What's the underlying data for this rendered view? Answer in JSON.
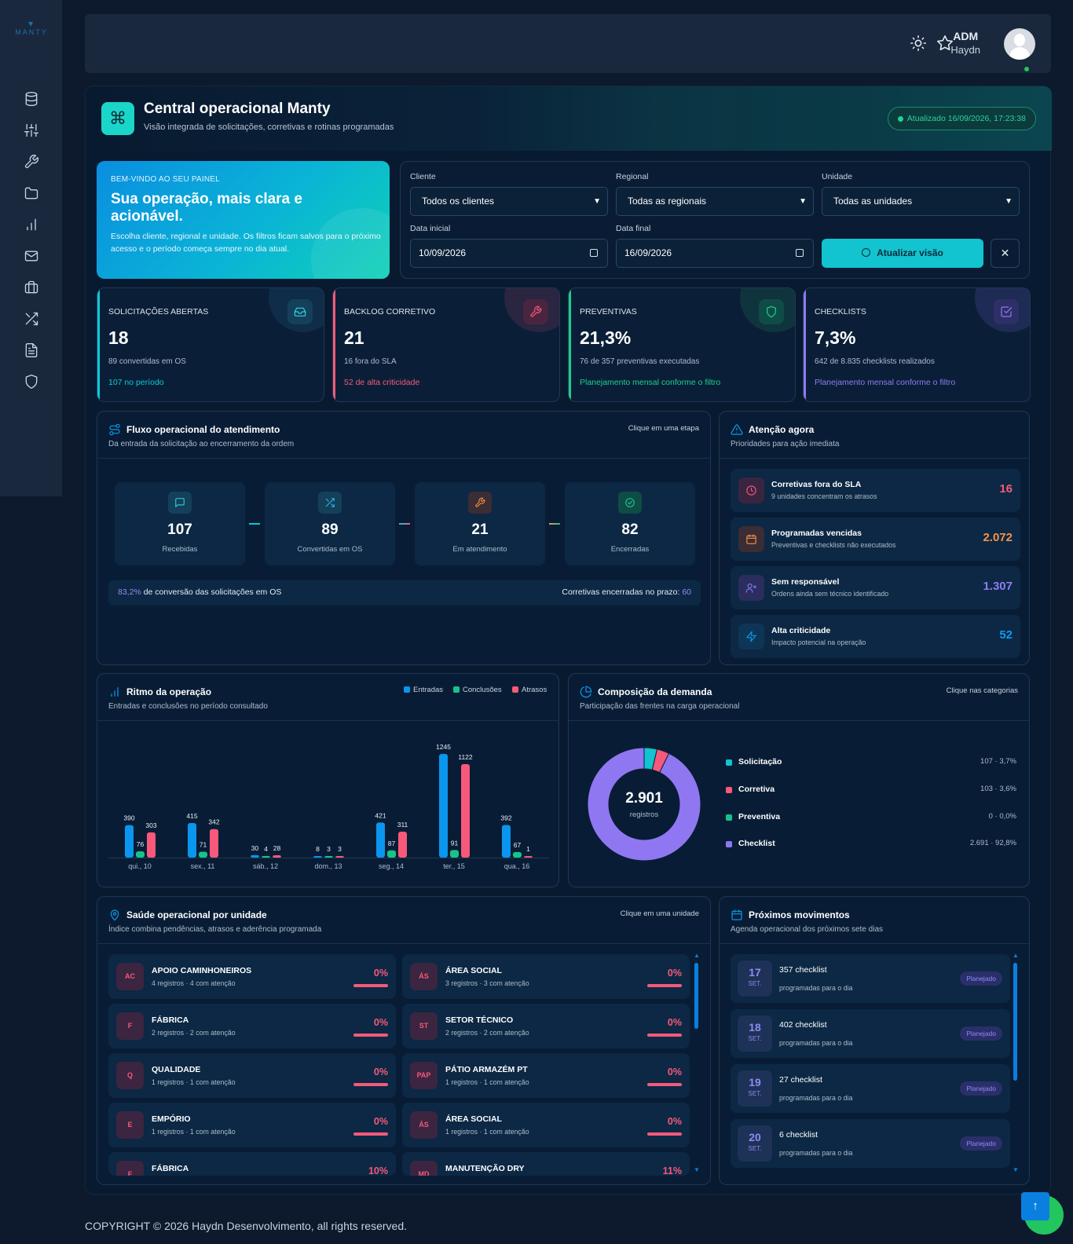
{
  "sidebar": {
    "logo": "MANTY",
    "icons": [
      "database-icon",
      "sliders-icon",
      "wrench-icon",
      "folder-icon",
      "bar-chart-icon",
      "mail-icon",
      "briefcase-icon",
      "shuffle-icon",
      "document-icon",
      "shield-icon"
    ]
  },
  "topbar": {
    "user_role": "ADM",
    "user_name": "Haydn"
  },
  "header": {
    "title": "Central operacional Manty",
    "subtitle": "Visão integrada de solicitações, corretivas e rotinas programadas",
    "updated": "Atualizado 16/09/2026, 17:23:38"
  },
  "welcome": {
    "eyebrow": "BEM-VINDO AO SEU PAINEL",
    "title": "Sua operação, mais clara e acionável.",
    "text": "Escolha cliente, regional e unidade. Os filtros ficam salvos para o próximo acesso e o período começa sempre no dia atual."
  },
  "filters": {
    "client_label": "Cliente",
    "client_value": "Todos os clientes",
    "region_label": "Regional",
    "region_value": "Todas as regionais",
    "unit_label": "Unidade",
    "unit_value": "Todas as unidades",
    "start_label": "Data inicial",
    "start_value": "10/09/2026",
    "end_label": "Data final",
    "end_value": "16/09/2026",
    "update_button": "Atualizar visão",
    "clear_button": "✕"
  },
  "kpis": [
    {
      "label": "SOLICITAÇÕES ABERTAS",
      "value": "18",
      "detail": "89 convertidas em OS",
      "note": "107 no período",
      "color": "#0fc9d6"
    },
    {
      "label": "BACKLOG CORRETIVO",
      "value": "21",
      "detail": "16 fora do SLA",
      "note": "52 de alta criticidade",
      "color": "#f6597a"
    },
    {
      "label": "PREVENTIVAS",
      "value": "21,3%",
      "detail": "76 de 357 preventivas executadas",
      "note": "Planejamento mensal conforme o filtro",
      "color": "#1fcf8e"
    },
    {
      "label": "CHECKLISTS",
      "value": "7,3%",
      "detail": "642 de 8.835 checklists realizados",
      "note": "Planejamento mensal conforme o filtro",
      "color": "#8f7bf2"
    }
  ],
  "flow": {
    "title": "Fluxo operacional do atendimento",
    "subtitle": "Da entrada da solicitação ao encerramento da ordem",
    "hint": "Clique em uma etapa",
    "steps": [
      {
        "value": "107",
        "label": "Recebidas"
      },
      {
        "value": "89",
        "label": "Convertidas em OS"
      },
      {
        "value": "21",
        "label": "Em atendimento"
      },
      {
        "value": "82",
        "label": "Encerradas"
      }
    ],
    "conversion_pct": "83,2%",
    "conversion_text": "de conversão das solicitações em OS",
    "ontime_label": "Corretivas encerradas no prazo:",
    "ontime_value": "60"
  },
  "attention": {
    "title": "Atenção agora",
    "subtitle": "Prioridades para ação imediata",
    "items": [
      {
        "title": "Corretivas fora do SLA",
        "desc": "9 unidades concentram os atrasos",
        "value": "16",
        "color": "#f6597a"
      },
      {
        "title": "Programadas vencidas",
        "desc": "Preventivas e checklists não executados",
        "value": "2.072",
        "color": "#f7924a"
      },
      {
        "title": "Sem responsável",
        "desc": "Ordens ainda sem técnico identificado",
        "value": "1.307",
        "color": "#8f7bf2"
      },
      {
        "title": "Alta criticidade",
        "desc": "Impacto potencial na operação",
        "value": "52",
        "color": "#0a9bf0"
      }
    ]
  },
  "rhythm": {
    "title": "Ritmo da operação",
    "subtitle": "Entradas e conclusões no período consultado",
    "legend": [
      "Entradas",
      "Conclusões",
      "Atrasos"
    ]
  },
  "chart_data": {
    "type": "bar",
    "categories": [
      "qui., 10",
      "sex., 11",
      "sáb., 12",
      "dom., 13",
      "seg., 14",
      "ter., 15",
      "qua., 16"
    ],
    "series": [
      {
        "name": "Entradas",
        "values": [
          390,
          415,
          30,
          8,
          421,
          1245,
          392
        ],
        "color": "#0a95ef"
      },
      {
        "name": "Conclusões",
        "values": [
          76,
          71,
          4,
          3,
          87,
          91,
          67
        ],
        "color": "#16c48a"
      },
      {
        "name": "Atrasos",
        "values": [
          303,
          342,
          28,
          3,
          311,
          1122,
          1
        ],
        "color": "#f6597a"
      }
    ],
    "ylim": [
      0,
      1245
    ]
  },
  "demand": {
    "title": "Composição da demanda",
    "subtitle": "Participação das frentes na carga operacional",
    "hint": "Clique nas categorias",
    "total": "2.901",
    "total_label": "registros",
    "slices": [
      {
        "name": "Solicitação",
        "value": 107,
        "text": "107 · 3,7%",
        "color": "#11c4cf"
      },
      {
        "name": "Corretiva",
        "value": 103,
        "text": "103 · 3,6%",
        "color": "#f6597a"
      },
      {
        "name": "Preventiva",
        "value": 0,
        "text": "0 · 0,0%",
        "color": "#16c48a"
      },
      {
        "name": "Checklist",
        "value": 2691,
        "text": "2.691 · 92,8%",
        "color": "#9077f2"
      }
    ]
  },
  "health": {
    "title": "Saúde operacional por unidade",
    "subtitle": "Índice combina pendências, atrasos e aderência programada",
    "hint": "Clique em uma unidade",
    "units": [
      {
        "badge": "AC",
        "name": "APOIO CAMINHONEIROS",
        "desc": "4 registros · 4 com atenção",
        "pct": "0%"
      },
      {
        "badge": "ÁS",
        "name": "ÁREA SOCIAL",
        "desc": "3 registros · 3 com atenção",
        "pct": "0%"
      },
      {
        "badge": "F",
        "name": "FÁBRICA",
        "desc": "2 registros · 2 com atenção",
        "pct": "0%"
      },
      {
        "badge": "ST",
        "name": "SETOR TÉCNICO",
        "desc": "2 registros · 2 com atenção",
        "pct": "0%"
      },
      {
        "badge": "Q",
        "name": "QUALIDADE",
        "desc": "1 registros · 1 com atenção",
        "pct": "0%"
      },
      {
        "badge": "PAP",
        "name": "PÁTIO ARMAZÉM PT",
        "desc": "1 registros · 1 com atenção",
        "pct": "0%"
      },
      {
        "badge": "E",
        "name": "EMPÓRIO",
        "desc": "1 registros · 1 com atenção",
        "pct": "0%"
      },
      {
        "badge": "ÁS",
        "name": "ÁREA SOCIAL",
        "desc": "1 registros · 1 com atenção",
        "pct": "0%"
      },
      {
        "badge": "F",
        "name": "FÁBRICA",
        "desc": "",
        "pct": "10%"
      },
      {
        "badge": "MD",
        "name": "MANUTENÇÃO DRY",
        "desc": "",
        "pct": "11%"
      }
    ]
  },
  "upcoming": {
    "title": "Próximos movimentos",
    "subtitle": "Agenda operacional dos próximos sete dias",
    "items": [
      {
        "day": "17",
        "month": "SET.",
        "title": "357 checklist",
        "desc": "programadas para o dia",
        "status": "Planejado"
      },
      {
        "day": "18",
        "month": "SET.",
        "title": "402 checklist",
        "desc": "programadas para o dia",
        "status": "Planejado"
      },
      {
        "day": "19",
        "month": "SET.",
        "title": "27 checklist",
        "desc": "programadas para o dia",
        "status": "Planejado"
      },
      {
        "day": "20",
        "month": "SET.",
        "title": "6 checklist",
        "desc": "programadas para o dia",
        "status": "Planejado"
      }
    ]
  },
  "footer": {
    "text": "COPYRIGHT © 2026 Haydn Desenvolvimento, all rights reserved."
  }
}
